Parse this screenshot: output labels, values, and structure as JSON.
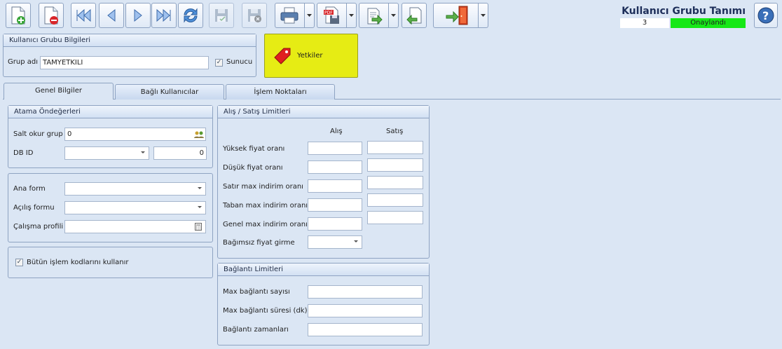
{
  "toolbar": {
    "buttons": [
      {
        "icon": "new-document-icon"
      },
      {
        "icon": "delete-document-icon"
      },
      {
        "icon": "first-record-icon"
      },
      {
        "icon": "previous-record-icon"
      },
      {
        "icon": "next-record-icon"
      },
      {
        "icon": "last-record-icon"
      },
      {
        "icon": "refresh-icon"
      },
      {
        "icon": "save-icon"
      },
      {
        "icon": "save-cancel-icon"
      },
      {
        "icon": "print-icon"
      },
      {
        "icon": "pdf-export-icon"
      },
      {
        "icon": "export-icon"
      },
      {
        "icon": "import-icon"
      },
      {
        "icon": "exit-door-icon"
      },
      {
        "icon": "help-icon"
      }
    ]
  },
  "header": {
    "title": "Kullanıcı Grubu Tanımı",
    "record_no": "3",
    "status": "Onaylandı",
    "status_color": "#16e816"
  },
  "group_info": {
    "title": "Kullanıcı Grubu Bilgileri",
    "name_label": "Grup adı",
    "name_value": "TAMYETKILI",
    "sunucu_label": "Sunucu",
    "sunucu_checked": true
  },
  "yetkiler_button": {
    "label": "Yetkiler",
    "color": "#e6ec14"
  },
  "tabs": [
    {
      "label": "Genel Bilgiler",
      "active": true
    },
    {
      "label": "Bağlı Kullanıcılar",
      "active": false
    },
    {
      "label": "İşlem Noktaları",
      "active": false
    }
  ],
  "defaults": {
    "title": "Atama Öndeğerleri",
    "salt_okur_label": "Salt okur grup",
    "salt_okur_value": "0",
    "db_id_label": "DB ID",
    "db_id_value": "",
    "db_id_number": "0"
  },
  "forms": {
    "ana_form_label": "Ana form",
    "ana_form_value": "",
    "acilis_label": "Açılış formu",
    "acilis_value": "",
    "calisma_label": "Çalışma profili",
    "calisma_value": ""
  },
  "islem_kodlari": {
    "label": "Bütün işlem kodlarını kullanır",
    "checked": true
  },
  "limits": {
    "title": "Alış / Satış Limitleri",
    "col_alis": "Alış",
    "col_satis": "Satış",
    "rows": [
      {
        "label": "Yüksek fiyat oranı",
        "alis": "",
        "satis": ""
      },
      {
        "label": "Düşük fiyat oranı",
        "alis": "",
        "satis": ""
      },
      {
        "label": "Satır max indirim oranı",
        "alis": "",
        "satis": ""
      },
      {
        "label": "Taban max indirim oranı",
        "alis": "",
        "satis": ""
      },
      {
        "label": "Genel max indirim oranı",
        "alis": "",
        "satis": ""
      }
    ],
    "bagimsiz_label": "Bağımsız fiyat girme",
    "bagimsiz_value": ""
  },
  "connection": {
    "title": "Bağlantı Limitleri",
    "rows": [
      {
        "label": "Max bağlantı sayısı",
        "value": ""
      },
      {
        "label": "Max bağlantı süresi (dk)",
        "value": ""
      },
      {
        "label": "Bağlantı zamanları",
        "value": ""
      }
    ]
  }
}
